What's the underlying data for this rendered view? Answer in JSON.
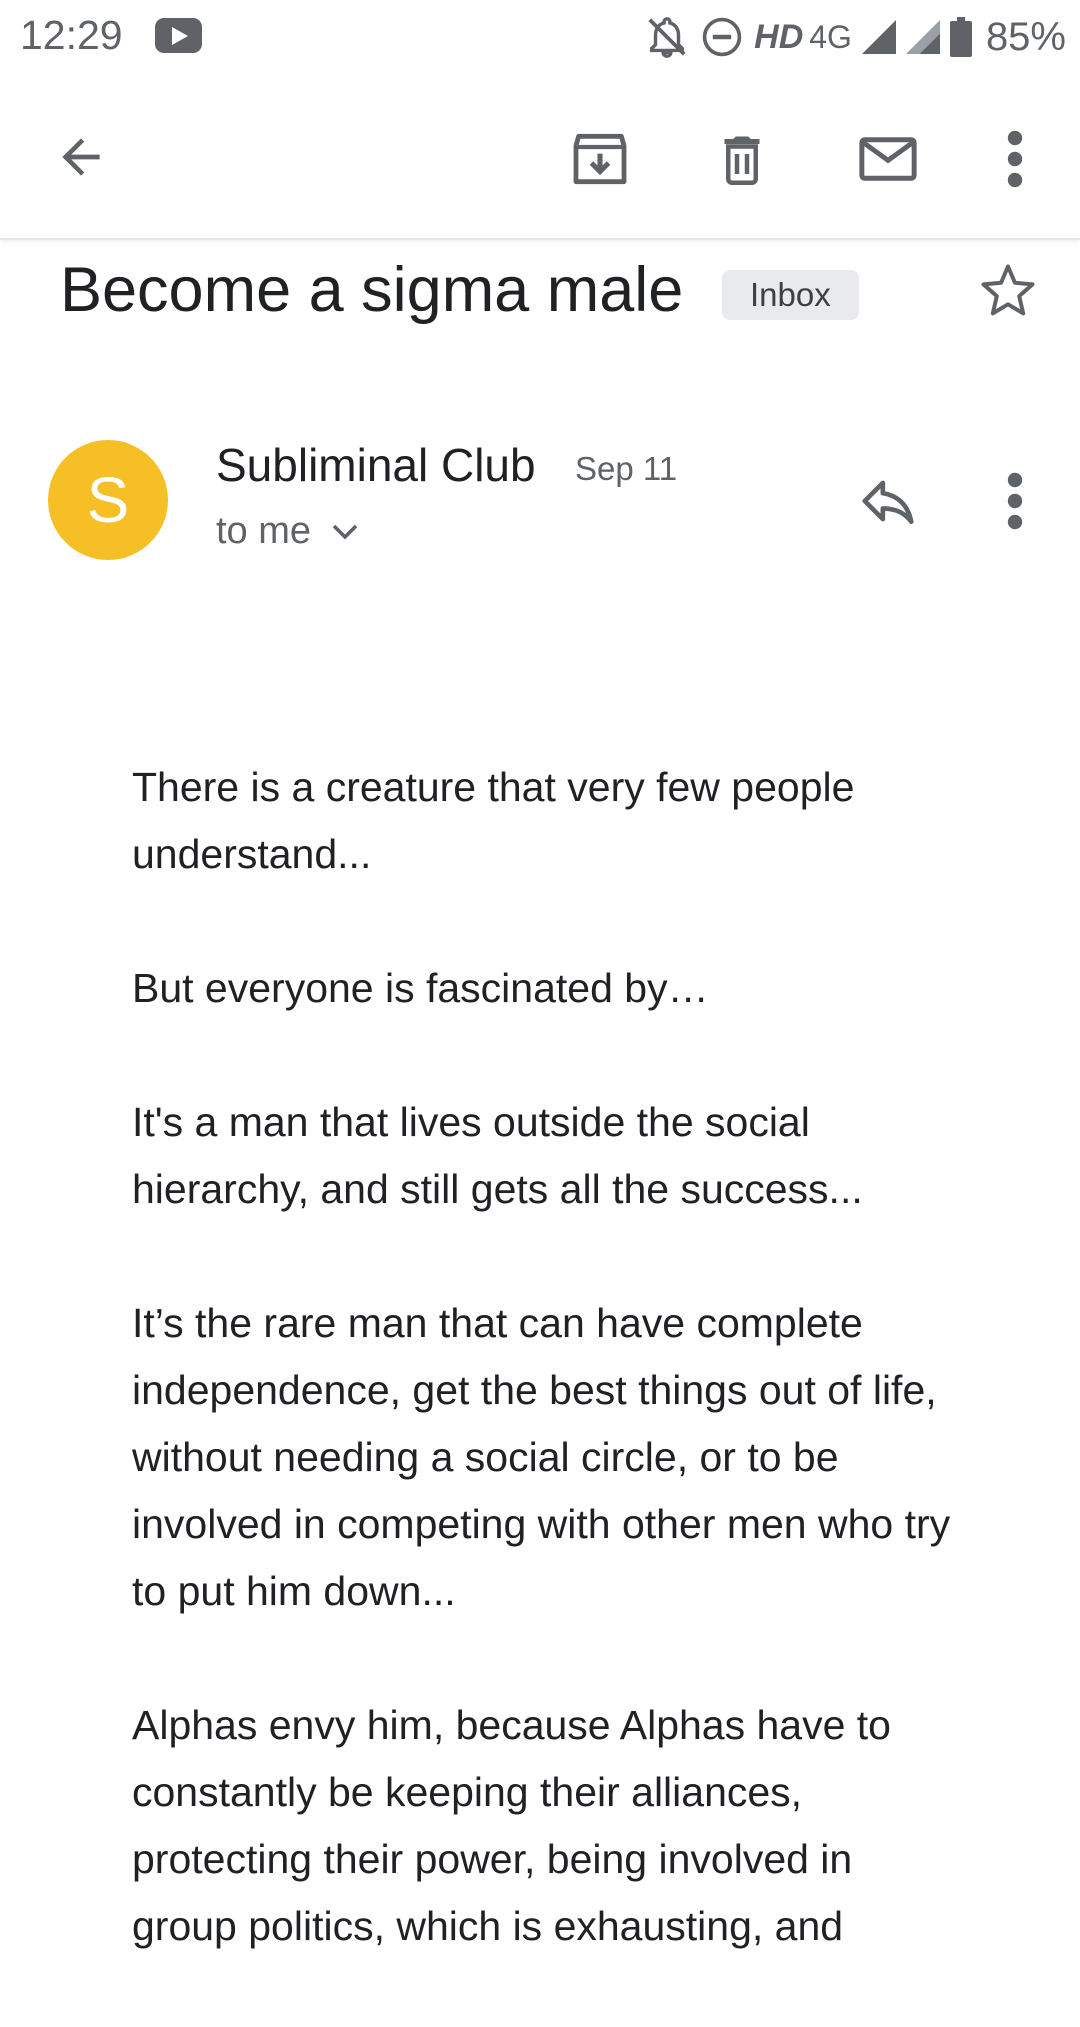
{
  "status_bar": {
    "time": "12:29",
    "network_hd": "HD",
    "network_type": "4G",
    "battery_percent": "85%",
    "icons": [
      "youtube-icon",
      "notifications-off-icon",
      "do-not-disturb-icon",
      "signal-icon",
      "signal-icon",
      "battery-icon"
    ]
  },
  "toolbar": {
    "icons": [
      "back-arrow-icon",
      "archive-icon",
      "delete-icon",
      "mark-unread-icon",
      "more-vert-icon"
    ]
  },
  "message": {
    "subject": "Become a sigma male",
    "label": "Inbox",
    "sender": {
      "initial": "S",
      "avatar_color": "#f6bf26",
      "name": "Subliminal Club",
      "date": "Sep 11",
      "recipient": "to me"
    },
    "paragraphs": [
      "There is a creature that very few people understand...",
      "But everyone is fascinated by…",
      "It's a man that lives outside the social hierarchy, and still gets all the success...",
      "It’s the rare man that can have complete independence, get the best things out of life, without needing a social circle, or to be involved in competing with other men who try to put him down...",
      "Alphas envy him, because Alphas have to constantly be keeping their alliances, protecting their power, being involved in group politics, which is exhausting, and"
    ]
  }
}
